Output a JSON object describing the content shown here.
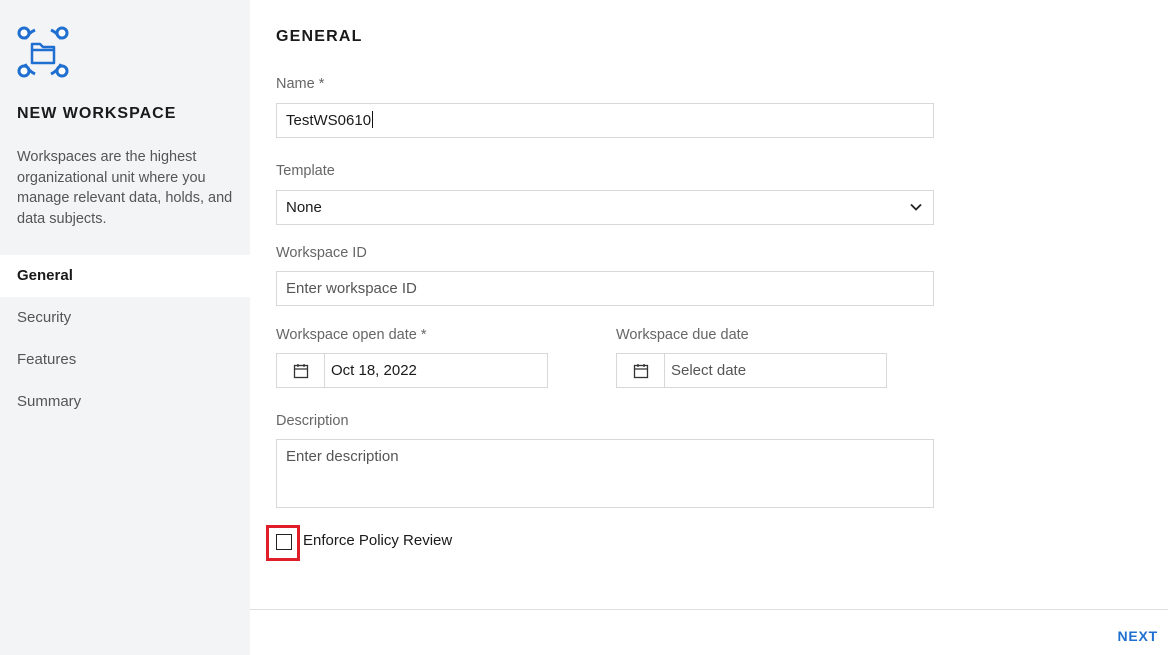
{
  "sidebar": {
    "logo_icon": "workspace-network-icon",
    "title": "NEW WORKSPACE",
    "description": "Workspaces are the highest organizational unit where you manage relevant data, holds, and data subjects.",
    "items": [
      {
        "label": "General",
        "active": true
      },
      {
        "label": "Security",
        "active": false
      },
      {
        "label": "Features",
        "active": false
      },
      {
        "label": "Summary",
        "active": false
      }
    ]
  },
  "main": {
    "section_title": "GENERAL",
    "name": {
      "label": "Name *",
      "value": "TestWS0610"
    },
    "template": {
      "label": "Template",
      "value": "None"
    },
    "workspace_id": {
      "label": "Workspace ID",
      "placeholder": "Enter workspace ID"
    },
    "open_date": {
      "label": "Workspace open date *",
      "value": "Oct 18, 2022"
    },
    "due_date": {
      "label": "Workspace due date",
      "placeholder": "Select date"
    },
    "description": {
      "label": "Description",
      "placeholder": "Enter description"
    },
    "enforce_policy": {
      "label": "Enforce Policy Review",
      "checked": false
    }
  },
  "footer": {
    "next_label": "NEXT"
  },
  "colors": {
    "accent": "#1f6fd1",
    "highlight": "#e01e2a",
    "sidebar_bg": "#f3f4f6"
  }
}
